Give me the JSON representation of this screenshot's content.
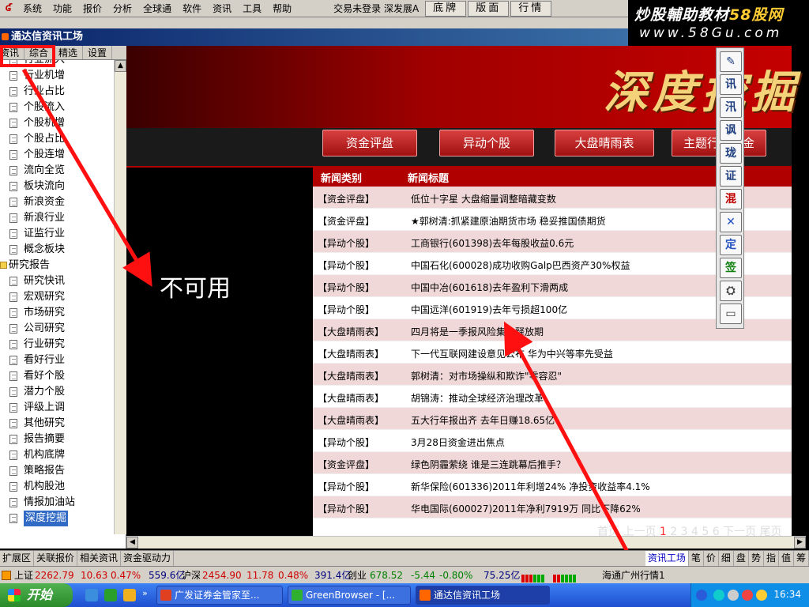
{
  "menubar": {
    "items": [
      "系统",
      "功能",
      "报价",
      "分析",
      "全球通",
      "软件",
      "资讯",
      "工具",
      "帮助"
    ],
    "status": "交易未登录  深发展A",
    "buttons": [
      "底牌",
      "版面",
      "行情"
    ]
  },
  "watermark": {
    "line1_prefix": "炒股輔助教材",
    "line1_site": "58股网",
    "line2": "www.58Gu.com"
  },
  "window": {
    "title": "通达信资讯工场"
  },
  "left_tabs": [
    "资讯",
    "综合",
    "精选",
    "设置"
  ],
  "tree": [
    {
      "label": "行业流入",
      "type": "doc"
    },
    {
      "label": "行业机增",
      "type": "doc"
    },
    {
      "label": "行业占比",
      "type": "doc"
    },
    {
      "label": "个股流入",
      "type": "doc"
    },
    {
      "label": "个股机增",
      "type": "doc"
    },
    {
      "label": "个股占比",
      "type": "doc"
    },
    {
      "label": "个股连增",
      "type": "doc"
    },
    {
      "label": "流向全览",
      "type": "doc"
    },
    {
      "label": "板块流向",
      "type": "doc"
    },
    {
      "label": "新浪资金",
      "type": "doc"
    },
    {
      "label": "新浪行业",
      "type": "doc"
    },
    {
      "label": "证监行业",
      "type": "doc"
    },
    {
      "label": "概念板块",
      "type": "doc"
    },
    {
      "label": "研究报告",
      "type": "folder"
    },
    {
      "label": "研究快讯",
      "type": "doc"
    },
    {
      "label": "宏观研究",
      "type": "doc"
    },
    {
      "label": "市场研究",
      "type": "doc"
    },
    {
      "label": "公司研究",
      "type": "doc"
    },
    {
      "label": "行业研究",
      "type": "doc"
    },
    {
      "label": "看好行业",
      "type": "doc"
    },
    {
      "label": "看好个股",
      "type": "doc"
    },
    {
      "label": "潜力个股",
      "type": "doc"
    },
    {
      "label": "评级上调",
      "type": "doc"
    },
    {
      "label": "其他研究",
      "type": "doc"
    },
    {
      "label": "报告摘要",
      "type": "doc"
    },
    {
      "label": "机构底牌",
      "type": "doc"
    },
    {
      "label": "策略报告",
      "type": "doc"
    },
    {
      "label": "机构股池",
      "type": "doc"
    },
    {
      "label": "情报加油站",
      "type": "doc"
    },
    {
      "label": "深度挖掘",
      "type": "doc",
      "selected": true
    }
  ],
  "banner": {
    "title": "深度挖掘"
  },
  "nav_buttons": [
    "资金评盘",
    "异动个股",
    "大盘晴雨表",
    "主题行业掘金"
  ],
  "news": {
    "header_category": "新闻类别",
    "header_title": "新闻标题",
    "rows": [
      {
        "category": "【资金评盘】",
        "title": "低位十字星  大盘缩量调整暗藏变数"
      },
      {
        "category": "【资金评盘】",
        "title": "★郭树清:抓紧建原油期货市场  稳妥推国债期货"
      },
      {
        "category": "【异动个股】",
        "title": "工商银行(601398)去年每股收益0.6元"
      },
      {
        "category": "【异动个股】",
        "title": "中国石化(600028)成功收购Galp巴西资产30%权益"
      },
      {
        "category": "【异动个股】",
        "title": "中国中冶(601618)去年盈利下滑两成"
      },
      {
        "category": "【异动个股】",
        "title": "中国远洋(601919)去年亏损超100亿"
      },
      {
        "category": "【大盘晴雨表】",
        "title": "四月将是一季报风险集中释放期"
      },
      {
        "category": "【大盘晴雨表】",
        "title": "下一代互联网建设意见公布  华为中兴等率先受益"
      },
      {
        "category": "【大盘晴雨表】",
        "title": "郭树清：对市场操纵和欺诈\"零容忍\""
      },
      {
        "category": "【大盘晴雨表】",
        "title": "胡锦涛：推动全球经济治理改革"
      },
      {
        "category": "【大盘晴雨表】",
        "title": "五大行年报出齐  去年日赚18.65亿"
      },
      {
        "category": "【异动个股】",
        "title": "3月28日资金进出焦点"
      },
      {
        "category": "【资金评盘】",
        "title": "绿色阴霾萦绕  谁是三连跳幕后推手？"
      },
      {
        "category": "【异动个股】",
        "title": "新华保险(601336)2011年利增24% 净投资收益率4.1%"
      },
      {
        "category": "【异动个股】",
        "title": "华电国际(600027)2011年净利7919万  同比下降62%"
      }
    ],
    "pager": {
      "prefix": "首页  上一页 ",
      "current": "1",
      "pages": " 2 3 4 5 6  下一页  尾页"
    }
  },
  "float_toolbar": [
    "✎",
    "讯",
    "汛",
    "讽",
    "珑",
    "证",
    "混",
    "✕",
    "定",
    "签",
    "⛭",
    "▭"
  ],
  "annotation": {
    "unusable": "不可用"
  },
  "bottom_tabs_left": [
    "扩展区",
    "关联报价",
    "相关资讯",
    "资金驱动力"
  ],
  "bottom_tabs_right": [
    "资讯工场",
    "笔",
    "价",
    "细",
    "盘",
    "势",
    "指",
    "值",
    "筹"
  ],
  "ticker": {
    "sh_label": "上证",
    "sh_value": "2262.79",
    "sh_change": "10.63",
    "sh_pct": "0.47%",
    "sh_amount": "559.6亿",
    "sz_label": "沪深",
    "sz_value": "2454.90",
    "sz_change": "11.78",
    "sz_pct": "0.48%",
    "sz_amount": "391.4亿",
    "cy_label": "创业",
    "cy_value": "678.52",
    "cy_change": "-5.44",
    "cy_pct": "-0.80%",
    "cy_amount": "75.25亿",
    "server": "海通广州行情1"
  },
  "taskbar": {
    "start": "开始",
    "tasks": [
      "广发证券金管家至...",
      "GreenBrowser - [...",
      "通达信资讯工场"
    ],
    "clock": "16:34"
  },
  "colors": {
    "accent_red": "#b00000",
    "news_alt_row": "#f0d8d8",
    "arrow_red": "#ff1010"
  }
}
